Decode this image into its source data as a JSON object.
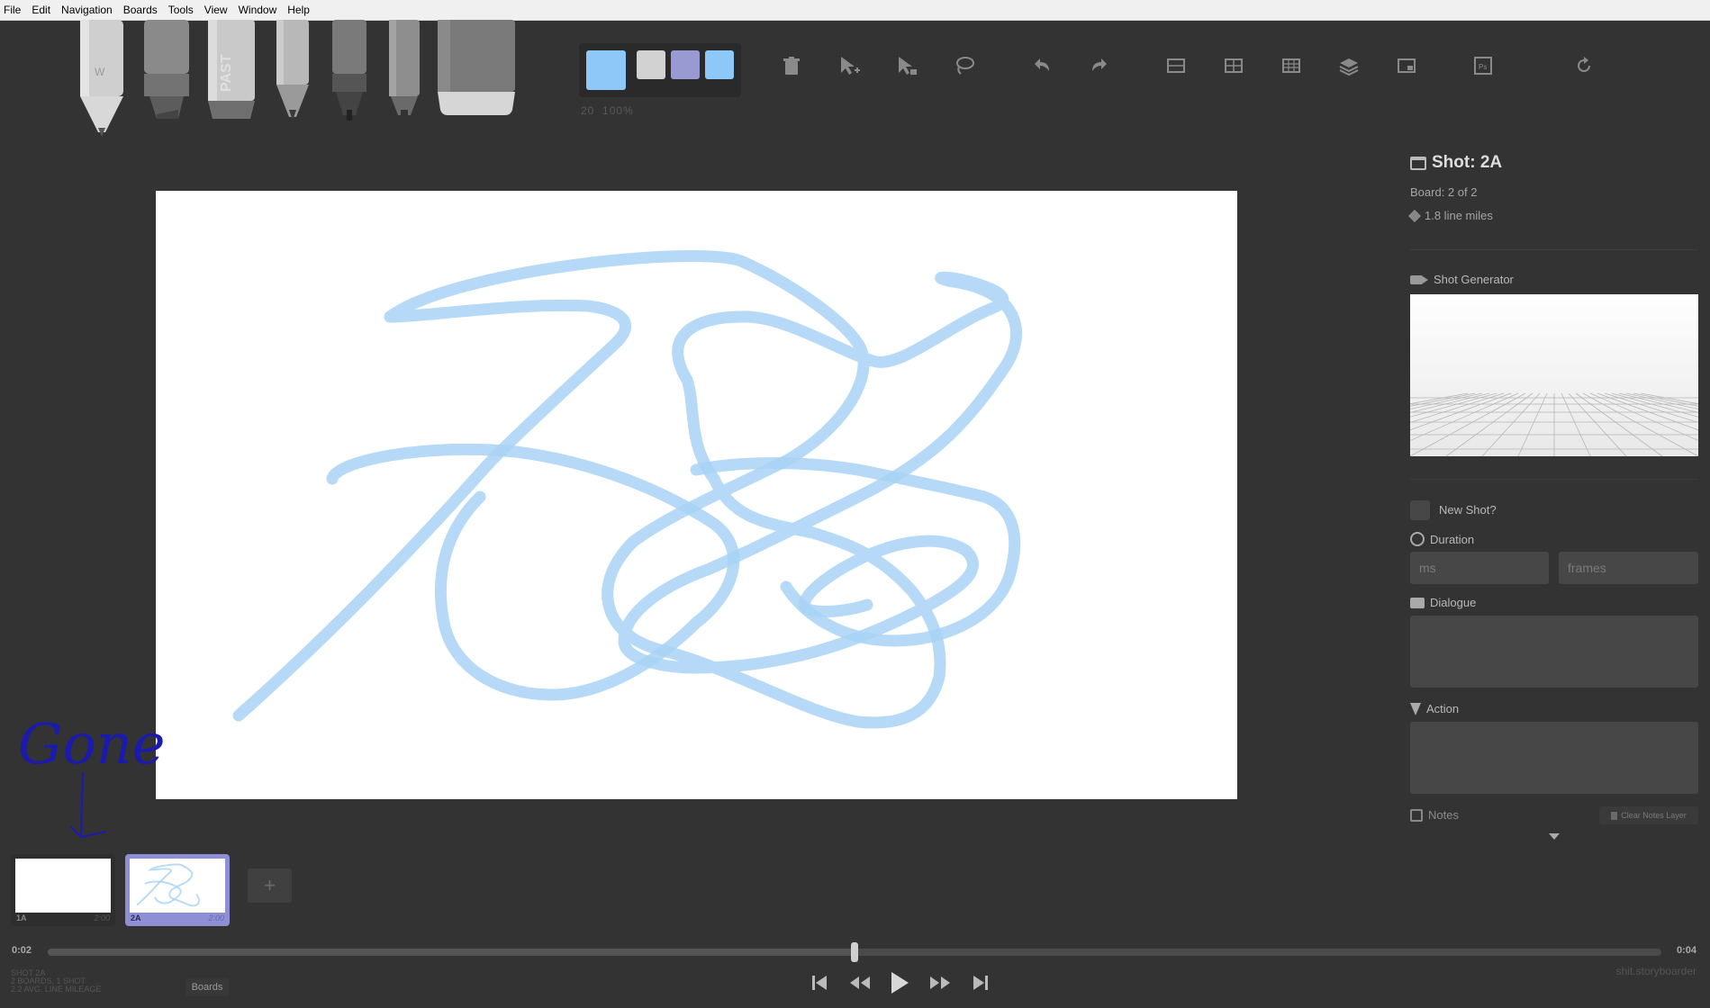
{
  "menu": [
    "File",
    "Edit",
    "Navigation",
    "Boards",
    "Tools",
    "View",
    "Window",
    "Help"
  ],
  "toolbar": {
    "tools": [
      "light-pencil",
      "marker",
      "pastel",
      "pencil",
      "pen",
      "brush",
      "eraser"
    ],
    "palette": {
      "current_color": "#8ec8f8",
      "swatches": [
        "#d2d2d2",
        "#9a9ad2",
        "#8ec8f8"
      ]
    },
    "brush_size": "20",
    "brush_opacity": "100%",
    "icons": [
      "trash-icon",
      "select-add-icon",
      "select-copy-icon",
      "lasso-icon",
      "undo-icon",
      "redo-icon",
      "grid-icon",
      "center-guides-icon",
      "thirds-icon",
      "layers-icon",
      "export-icon",
      "photoshop-icon",
      "refresh-icon"
    ]
  },
  "sidebar": {
    "shot_title": "Shot: 2A",
    "board_position": "Board: 2 of 2",
    "line_mileage": "1.8 line miles",
    "shot_generator_label": "Shot Generator",
    "new_shot_label": "New Shot?",
    "duration_label": "Duration",
    "duration_ms_placeholder": "ms",
    "duration_frames_placeholder": "frames",
    "dialogue_label": "Dialogue",
    "action_label": "Action",
    "notes_label": "Notes",
    "clear_notes_label": "Clear Notes Layer"
  },
  "boards": [
    {
      "label": "1A",
      "duration": "2:00",
      "selected": false
    },
    {
      "label": "2A",
      "duration": "2:00",
      "selected": true
    }
  ],
  "add_board_label": "+",
  "timeline": {
    "current_time": "0:02",
    "total_time": "0:04",
    "position": 0.5
  },
  "status": {
    "line1": "SHOT 2A",
    "line2": "2 BOARDS, 1 SHOT",
    "line3": "2.2 AVG. LINE MILEAGE"
  },
  "boards_button": "Boards",
  "filename": "shit.storyboarder",
  "annotation_text": "Gone",
  "accent_color": "#8f8fd6",
  "stroke_color": "#a8d2f4"
}
